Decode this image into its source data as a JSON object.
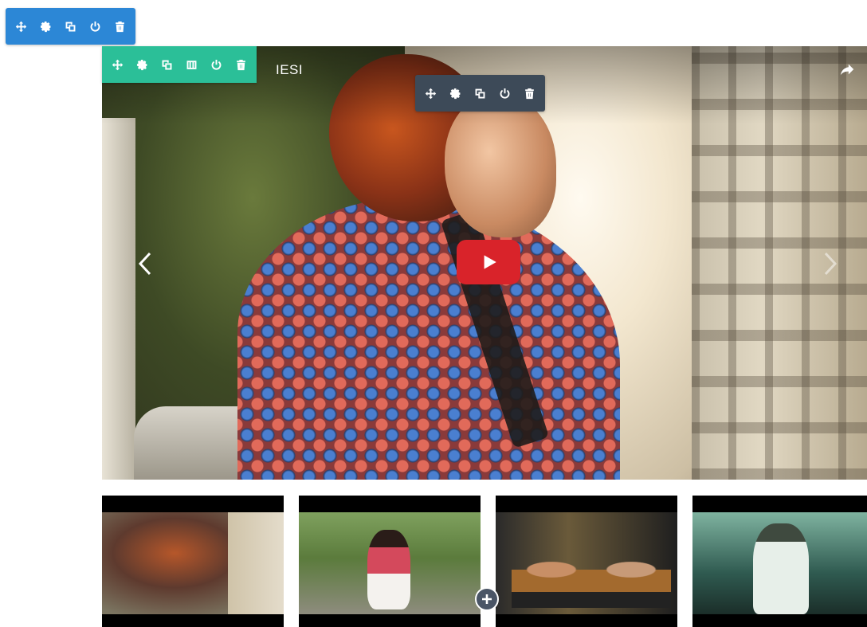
{
  "video": {
    "title": "IESI"
  },
  "toolbars": {
    "section": [
      "move-icon",
      "settings-icon",
      "duplicate-icon",
      "save-icon",
      "delete-icon"
    ],
    "row": [
      "move-icon",
      "settings-icon",
      "duplicate-icon",
      "columns-icon",
      "save-icon",
      "delete-icon"
    ],
    "widget": [
      "move-icon",
      "settings-icon",
      "duplicate-icon",
      "save-icon",
      "delete-icon"
    ]
  },
  "colors": {
    "section_toolbar": "#2c87d6",
    "row_toolbar": "#2bbf98",
    "widget_toolbar": "#3d4a58",
    "play_button": "#d9232a"
  },
  "thumbnails": [
    "thumb-1",
    "thumb-2",
    "thumb-3",
    "thumb-4"
  ]
}
